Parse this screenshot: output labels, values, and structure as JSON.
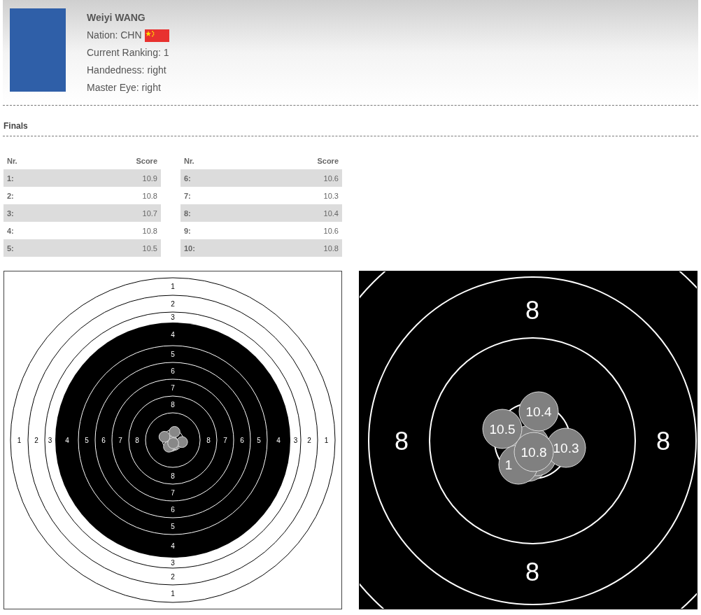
{
  "athlete": {
    "name": "Weiyi WANG",
    "nation_label": "Nation: CHN",
    "ranking": "Current Ranking: 1",
    "handedness": "Handedness: right",
    "master_eye": "Master Eye: right"
  },
  "finals": {
    "title": "Finals",
    "tables": [
      {
        "columns": [
          "Nr.",
          "Score"
        ],
        "rows": [
          {
            "nr": "1:",
            "score": "10.9"
          },
          {
            "nr": "2:",
            "score": "10.8"
          },
          {
            "nr": "3:",
            "score": "10.7"
          },
          {
            "nr": "4:",
            "score": "10.8"
          },
          {
            "nr": "5:",
            "score": "10.5"
          }
        ]
      },
      {
        "columns": [
          "Nr.",
          "Score"
        ],
        "rows": [
          {
            "nr": "6:",
            "score": "10.6"
          },
          {
            "nr": "7:",
            "score": "10.3"
          },
          {
            "nr": "8:",
            "score": "10.4"
          },
          {
            "nr": "9:",
            "score": "10.6"
          },
          {
            "nr": "10:",
            "score": "10.8"
          }
        ]
      }
    ]
  },
  "target": {
    "rings": [
      {
        "labels": [
          "1",
          "1",
          "1",
          "1"
        ]
      },
      {
        "labels": [
          "2",
          "2",
          "2",
          "2"
        ]
      },
      {
        "labels": [
          "3",
          "3",
          "3",
          "3"
        ]
      },
      {
        "labels": [
          "4",
          "4",
          "4",
          "4"
        ]
      },
      {
        "labels": [
          "5",
          "5",
          "5",
          "5"
        ]
      },
      {
        "labels": [
          "6",
          "6",
          "6",
          "6"
        ]
      },
      {
        "labels": [
          "7",
          "7",
          "7",
          "7"
        ]
      },
      {
        "labels": [
          "8",
          "8",
          "8",
          "8"
        ]
      }
    ]
  },
  "zoom_target": {
    "ring_labels": [
      "8",
      "8",
      "8",
      "8"
    ],
    "shots": [
      {
        "label": "1"
      },
      {
        "label": "10.5"
      },
      {
        "label": "10.4"
      },
      {
        "label": "10.3"
      },
      {
        "label": "10.8"
      }
    ]
  }
}
